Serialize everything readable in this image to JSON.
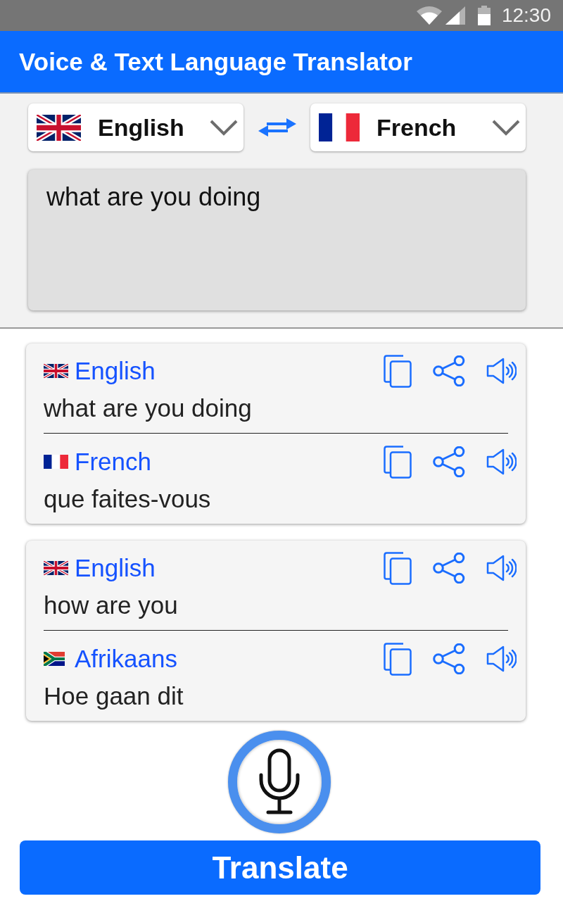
{
  "status_bar": {
    "time": "12:30"
  },
  "app_bar": {
    "title": "Voice & Text Language Translator"
  },
  "language_bar": {
    "source": {
      "kind": "gb",
      "language": "English"
    },
    "target": {
      "kind": "fr",
      "language": "French"
    }
  },
  "input": {
    "value": "what are you doing"
  },
  "history_cards": [
    {
      "source": {
        "kind": "gb",
        "language": "English",
        "text": "what are you doing"
      },
      "target": {
        "kind": "fr",
        "language": "French",
        "text": "que faites-vous"
      }
    },
    {
      "source": {
        "kind": "gb",
        "language": "English",
        "text": "how are you"
      },
      "target": {
        "kind": "za",
        "language": "Afrikaans",
        "text": "Hoe gaan dit"
      }
    }
  ],
  "translate_button": {
    "label": "Translate"
  }
}
